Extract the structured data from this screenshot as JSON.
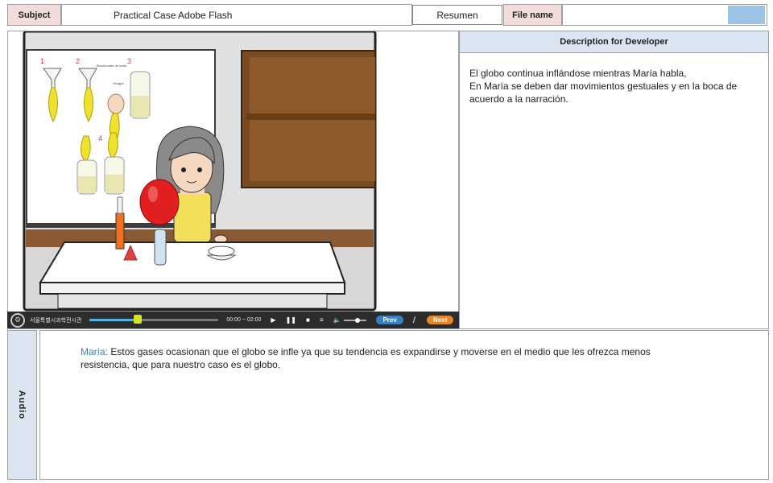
{
  "header": {
    "subject_label": "Subject",
    "subject_value": "Practical Case Adobe Flash",
    "resumen_button": "Resumen",
    "file_name_label": "File name",
    "file_name_value": ""
  },
  "description": {
    "title": "Description for Developer",
    "lines": [
      "El globo continua inflándose mientras María habla,",
      "En María se deben dar movimientos gestuales y en la boca de acuerdo a la narración."
    ]
  },
  "scene": {
    "poster_steps": [
      "1",
      "2",
      "3",
      "4"
    ],
    "poster_note_1": "Bicarbonato de sodio",
    "poster_note_2": "Vinagre"
  },
  "player": {
    "org_name": "서울특별시과학전시관",
    "time": "00:00 ~ 02:00",
    "progress": 0.37,
    "volume": 0.6,
    "prev_label": "Prev",
    "separator": "/",
    "next_label": "Next"
  },
  "audio": {
    "tab_label": "Audio",
    "speaker": "María:",
    "text": "Estos gases ocasionan que el globo se infle ya que su tendencia es expandirse y moverse en el medio que les ofrezca menos resistencia, que para nuestro caso es el globo."
  },
  "colors": {
    "label_bg": "#f2dcdb",
    "panel_header_bg": "#dbe5f1",
    "accent_blue": "#9dc3e6",
    "speaker_color": "#3a7fc4",
    "balloon_red": "#e02020"
  }
}
